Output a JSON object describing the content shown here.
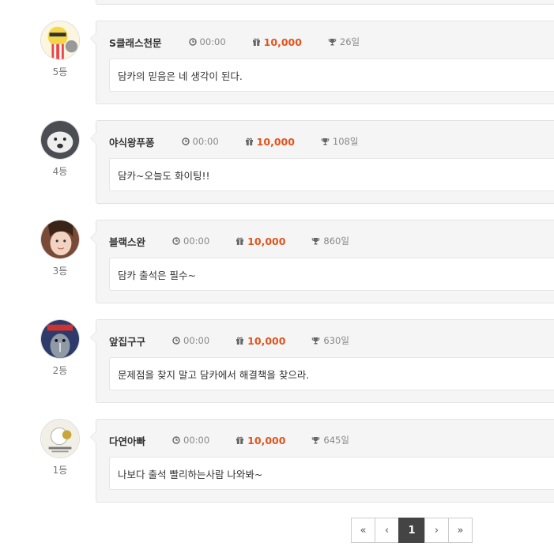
{
  "entries": [
    {
      "name": "S클래스천문",
      "time": "00:00",
      "points": "10,000",
      "days": "26일",
      "message": "담카의 믿음은 네 생각이 된다.",
      "rank": "5등"
    },
    {
      "name": "야식왕푸퐁",
      "time": "00:00",
      "points": "10,000",
      "days": "108일",
      "message": "담카~오늘도 화이팅!!",
      "rank": "4등"
    },
    {
      "name": "블랙스완",
      "time": "00:00",
      "points": "10,000",
      "days": "860일",
      "message": "담카 출석은 필수~",
      "rank": "3등"
    },
    {
      "name": "앞집구구",
      "time": "00:00",
      "points": "10,000",
      "days": "630일",
      "message": "문제점을 찾지 말고 담카에서 해결책을 찾으라.",
      "rank": "2등"
    },
    {
      "name": "다연아빠",
      "time": "00:00",
      "points": "10,000",
      "days": "645일",
      "message": "나보다 출석 빨리하는사람 나와봐~",
      "rank": "1등"
    }
  ],
  "pagination": {
    "first": "«",
    "prev": "‹",
    "current": "1",
    "next": "›",
    "last": "»"
  },
  "colors": {
    "points": "#e2541d",
    "active_page": "#444444",
    "card_bg": "#f5f5f5"
  },
  "icons": {
    "time": "clock-icon",
    "points": "gift-icon",
    "days": "trophy-icon"
  }
}
